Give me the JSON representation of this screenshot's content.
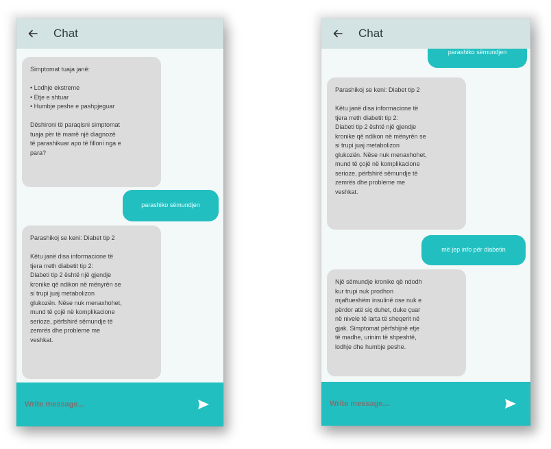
{
  "screens": [
    {
      "header": {
        "title": "Chat"
      },
      "messages": [
        {
          "sender": "bot",
          "text": "Simptomat tuaja janë:\n\n• Lodhje ekstreme\n• Etje e shtuar\n• Humbje peshe e pashpjeguar\n\nDëshironi të paraqisni simptomat\ntuaja për të marrë një diagnozë\ntë parashikuar apo të filloni nga e\npara?"
        },
        {
          "sender": "user",
          "text": "parashiko sëmundjen"
        },
        {
          "sender": "bot",
          "text": "Parashikoj se keni: Diabet tip 2\n\nKëtu janë disa informacione të\ntjera rreth diabetit tip 2:\nDiabeti tip 2 është një gjendje\nkronike që ndikon në mënyrën se\nsi trupi juaj metabolizon\nglukozën. Nëse nuk menaxhohet,\nmund të çojë në komplikacione\nserioze, përfshirë sëmundje të\nzemrës dhe probleme me\nveshkat."
        }
      ],
      "input": {
        "placeholder": "Write message..."
      }
    },
    {
      "header": {
        "title": "Chat"
      },
      "messages": [
        {
          "sender": "user",
          "text": "parashiko sëmundjen"
        },
        {
          "sender": "bot",
          "text": "Parashikoj se keni: Diabet tip 2\n\nKëtu janë disa informacione të\ntjera rreth diabetit tip 2:\nDiabeti tip 2 është një gjendje\nkronike që ndikon në mënyrën se\nsi trupi juaj metabolizon\nglukozën. Nëse nuk menaxhohet,\nmund të çojë në komplikacione\nserioze, përfshirë sëmundje të\nzemrës dhe probleme me\nveshkat."
        },
        {
          "sender": "user",
          "text": "më jep info për diabetin"
        },
        {
          "sender": "bot",
          "text": "Një sëmundje kronike që ndodh\nkur trupi nuk prodhon\nmjaftueshëm insulinë ose nuk e\npërdor atë siç duhet, duke çuar\nnë nivele të larta të sheqerit në\ngjak. Simptomat përfshijnë etje\ntë madhe, urinim të shpeshtë,\nlodhje dhe humbje peshe."
        }
      ],
      "input": {
        "placeholder": "Write message..."
      }
    }
  ],
  "colors": {
    "accent": "#22bfc0",
    "appbar": "#d3e2e2",
    "bot_bubble": "#dcdcdc",
    "background": "#f3f8f8"
  },
  "icons": {
    "back": "arrow-left-icon",
    "send": "send-icon"
  }
}
